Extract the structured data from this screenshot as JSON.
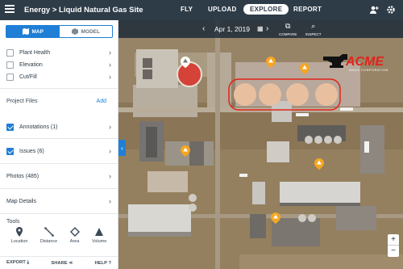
{
  "topbar": {
    "breadcrumb": "Energy > Liquid Natural Gas Site",
    "nav": [
      {
        "label": "FLY",
        "active": false
      },
      {
        "label": "UPLOAD",
        "active": false
      },
      {
        "label": "EXPLORE",
        "active": true
      },
      {
        "label": "REPORT",
        "active": false
      }
    ],
    "icons": [
      "menu-icon",
      "add-user-icon",
      "gear-icon"
    ]
  },
  "sidebar": {
    "view_toggle": {
      "map_label": "MAP",
      "model_label": "MODEL",
      "selected": "MAP"
    },
    "layers": [
      {
        "label": "Plant Health",
        "checked": false
      },
      {
        "label": "Elevation",
        "checked": false
      },
      {
        "label": "Cut/Fill",
        "checked": false
      }
    ],
    "project_files_title": "Project Files",
    "add_label": "Add",
    "files": [
      {
        "label": "Annotations (1)",
        "checked": true
      },
      {
        "label": "Issues (6)",
        "checked": true
      }
    ],
    "photos_label": "Photos (485)",
    "map_details_label": "Map Details",
    "tools_title": "Tools",
    "tools": [
      {
        "label": "Location",
        "icon": "location-pin-icon"
      },
      {
        "label": "Distance",
        "icon": "distance-line-icon"
      },
      {
        "label": "Area",
        "icon": "area-polygon-icon"
      },
      {
        "label": "Volume",
        "icon": "volume-cone-icon"
      }
    ],
    "footer": {
      "export_label": "EXPORT",
      "share_label": "SHARE",
      "help_label": "HELP"
    }
  },
  "map": {
    "date_label": "Apr 1, 2019",
    "compare_label": "COMPARE",
    "inspect_label": "INSPECT",
    "logo_text": "ACME",
    "logo_subtext": "ANVIL CORPORATION",
    "accent_color": "#e2231a",
    "pin_color": "#f5a623"
  }
}
